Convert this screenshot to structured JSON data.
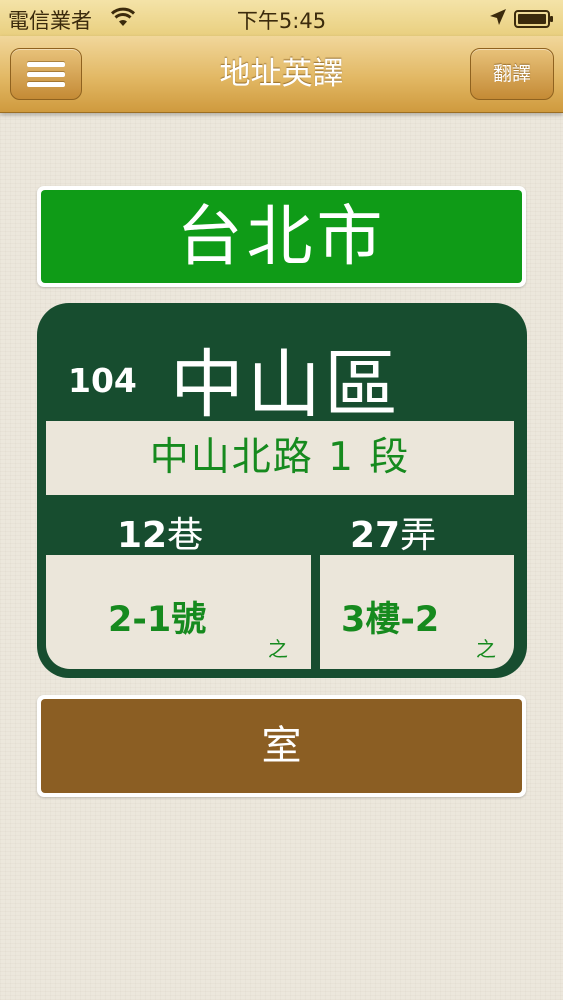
{
  "status_bar": {
    "carrier": "電信業者",
    "time": "下午5:45",
    "wifi_icon": "wifi-icon",
    "location_icon": "location-arrow-icon",
    "battery_icon": "battery-icon"
  },
  "nav": {
    "title": "地址英譯",
    "menu_icon": "hamburger-menu-icon",
    "translate_label": "翻譯"
  },
  "address": {
    "city": "台北市",
    "zip": "104",
    "district": "中山區",
    "road": "中山北路 1 段",
    "lane_number": "12",
    "lane_unit": "巷",
    "alley_number": "27",
    "alley_unit": "弄",
    "house_number": "2-1號",
    "house_suffix": "之",
    "floor": "3樓-2",
    "floor_suffix": "之",
    "room": "室"
  },
  "colors": {
    "city_green": "#0f9b17",
    "panel_green": "#174d2f",
    "text_green": "#168a1e",
    "room_brown": "#8b5e23",
    "nav_gold": "#e2b864"
  }
}
